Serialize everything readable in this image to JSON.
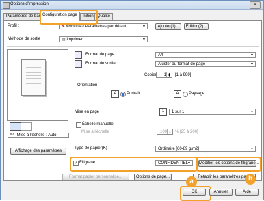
{
  "window": {
    "title": "Options d'impression",
    "close_glyph": "×"
  },
  "tabs": [
    {
      "label": "Paramètres de bas"
    },
    {
      "label": "Configuration page"
    },
    {
      "label": "inition"
    },
    {
      "label": "Qualité"
    }
  ],
  "profile": {
    "label": "Profil :",
    "value": "<Modifié> Paramètres par défaut",
    "add": "Ajouter(1)...",
    "edit": "Édition(2)..."
  },
  "output_method": {
    "label": "Méthode de sortie :",
    "value": "Imprimer"
  },
  "page": {
    "format_label": "Format de page :",
    "format_value": "A4",
    "output_format_label": "Format de sortie :",
    "output_format_value": "Ajuster au format de page",
    "copies_label": "Copies :",
    "copies_value": "1",
    "copies_range": "[1 à 999]",
    "orientation_label": "Orientation",
    "portrait": "Portrait",
    "landscape": "Paysage",
    "layout_label": "Mise en page :",
    "layout_value": "1 sur 1",
    "manual_scale_label": "Échelle manuelle",
    "scale_label": "Mise à l'échelle :",
    "scale_value": "100",
    "scale_range": "% [25 à 200]"
  },
  "preview_caption": "A4 [Mise à l'échelle : Auto]",
  "show_settings": "Affichage des paramètres",
  "paper_type": {
    "label": "Type de papier(K) :",
    "value": "Ordinaire [60-89 g/m2]"
  },
  "watermark": {
    "label": "Filigrane",
    "value": "CONFIDENTIEL",
    "edit": "Modifier les options de filigrane..."
  },
  "buttons": {
    "custom_paper": "Format papier personnalisé...",
    "page_options": "Options de page...",
    "restore_defaults": "Rétablir les paramètres par d",
    "ok": "OK",
    "cancel": "Annuler",
    "help": "Aide"
  },
  "callouts": {
    "a": "a",
    "b": "b"
  },
  "colors": {
    "highlight": "#f2a12a",
    "accent": "#2a6ad3"
  }
}
